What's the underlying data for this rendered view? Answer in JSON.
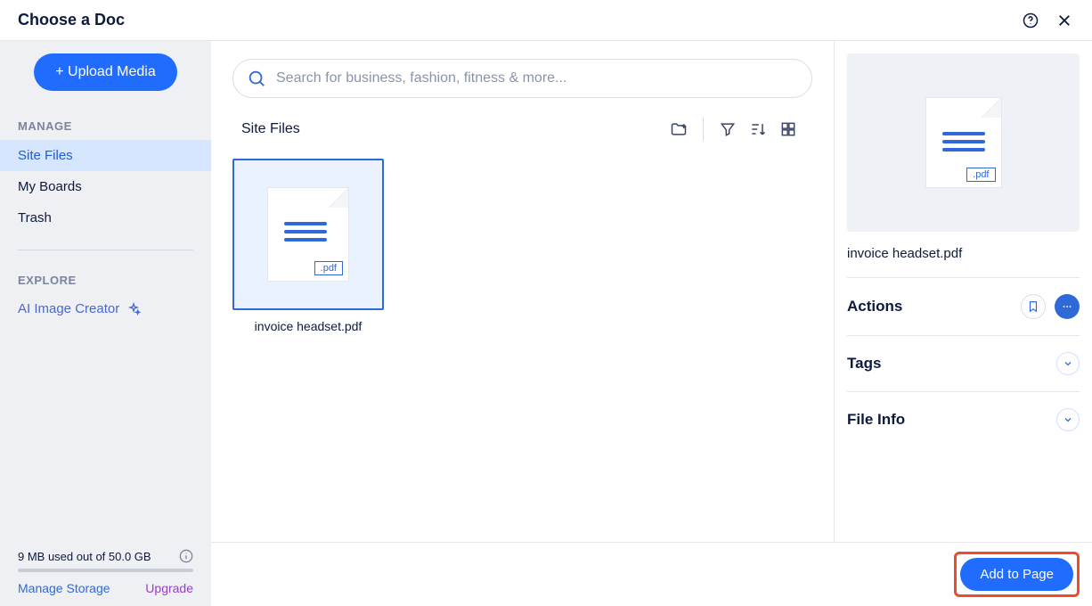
{
  "header": {
    "title": "Choose a Doc"
  },
  "sidebar": {
    "upload_label": "+ Upload Media",
    "manage_label": "MANAGE",
    "explore_label": "EXPLORE",
    "items": [
      {
        "label": "Site Files",
        "active": true
      },
      {
        "label": "My Boards",
        "active": false
      },
      {
        "label": "Trash",
        "active": false
      }
    ],
    "ai_label": "AI Image Creator",
    "storage_text": "9 MB used out of 50.0 GB",
    "manage_storage": "Manage Storage",
    "upgrade": "Upgrade"
  },
  "search": {
    "placeholder": "Search for business, fashion, fitness & more..."
  },
  "toolbar": {
    "title": "Site Files"
  },
  "files": [
    {
      "name": "invoice headset.pdf",
      "ext": ".pdf",
      "selected": true
    }
  ],
  "details": {
    "filename": "invoice headset.pdf",
    "ext": ".pdf",
    "actions_label": "Actions",
    "tags_label": "Tags",
    "fileinfo_label": "File Info"
  },
  "footer": {
    "add_label": "Add to Page"
  }
}
